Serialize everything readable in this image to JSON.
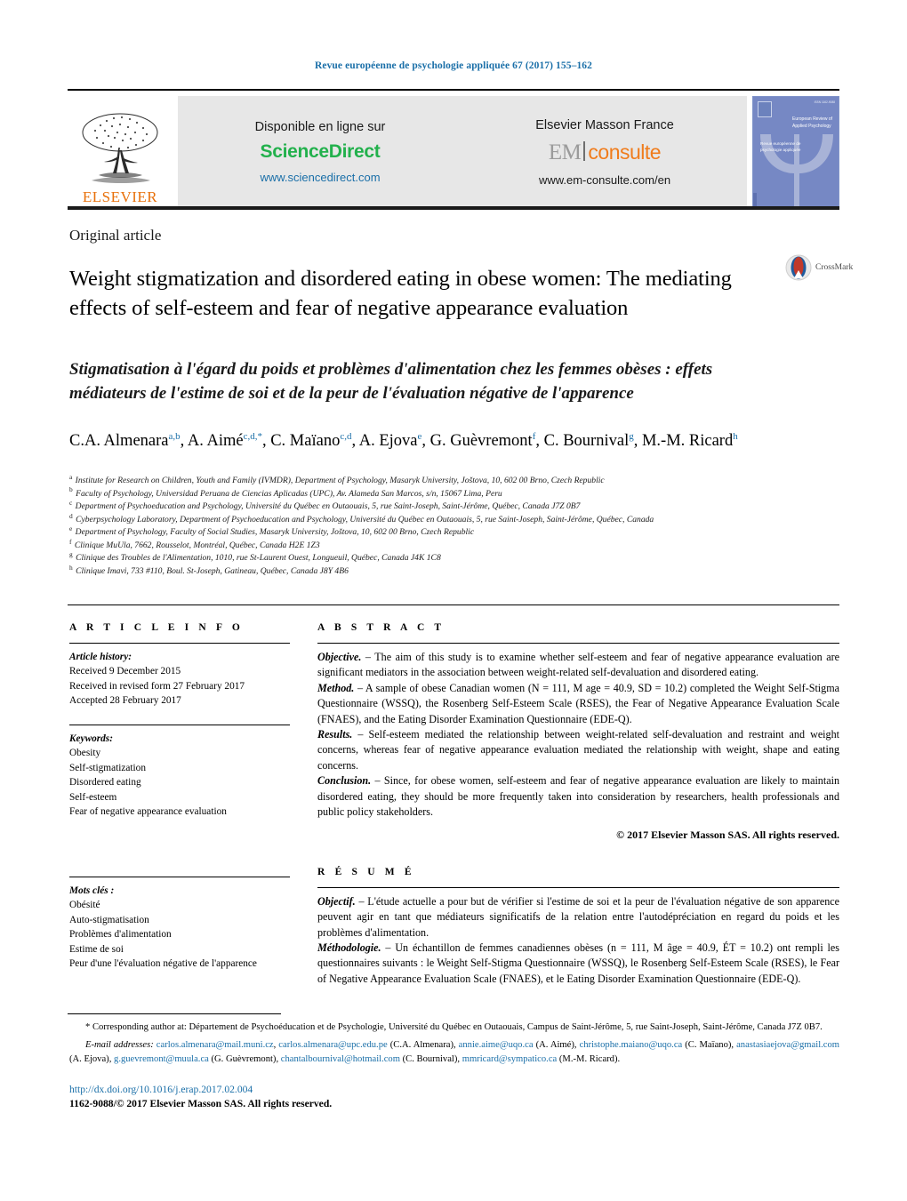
{
  "running_head": "Revue européenne de psychologie appliquée 67 (2017) 155–162",
  "masthead": {
    "publisher_logo_word": "ELSEVIER",
    "left_panel": {
      "lead": "Disponible en ligne sur",
      "brand": "ScienceDirect",
      "url": "www.sciencedirect.com"
    },
    "right_panel": {
      "lead": "Elsevier Masson France",
      "brand_em": "EM",
      "brand_consulte": "consulte",
      "url": "www.em-consulte.com/en"
    },
    "cover": {
      "title_line": "European Review of Applied Psychology",
      "title_line_fr": "Revue européenne de psychologie appliquée",
      "top_right": "ISSN 1162-9088"
    }
  },
  "article_type": "Original article",
  "crossmark": {
    "label": "CrossMark"
  },
  "title_en": "Weight stigmatization and disordered eating in obese women: The mediating effects of self-esteem and fear of negative appearance evaluation",
  "title_fr": "Stigmatisation à l'égard du poids et problèmes d'alimentation chez les femmes obèses : effets médiateurs de l'estime de soi et de la peur de l'évaluation négative de l'apparence",
  "authors": [
    {
      "name": "C.A. Almenara",
      "marks": "a,b"
    },
    {
      "name": "A. Aimé",
      "marks": "c,d,*"
    },
    {
      "name": "C. Maïano",
      "marks": "c,d"
    },
    {
      "name": "A. Ejova",
      "marks": "e"
    },
    {
      "name": "G. Guèvremont",
      "marks": "f"
    },
    {
      "name": "C. Bournival",
      "marks": "g"
    },
    {
      "name": "M.-M. Ricard",
      "marks": "h"
    }
  ],
  "affiliations": [
    {
      "mark": "a",
      "text": "Institute for Research on Children, Youth and Family (IVMDR), Department of Psychology, Masaryk University, Joštova, 10, 602 00 Brno, Czech Republic"
    },
    {
      "mark": "b",
      "text": "Faculty of Psychology, Universidad Peruana de Ciencias Aplicadas (UPC), Av. Alameda San Marcos, s/n, 15067 Lima, Peru"
    },
    {
      "mark": "c",
      "text": "Department of Psychoeducation and Psychology, Université du Québec en Outaouais, 5, rue Saint-Joseph, Saint-Jérôme, Québec, Canada J7Z 0B7"
    },
    {
      "mark": "d",
      "text": "Cyberpsychology Laboratory, Department of Psychoeducation and Psychology, Université du Québec en Outaouais, 5, rue Saint-Joseph, Saint-Jérôme, Québec, Canada"
    },
    {
      "mark": "e",
      "text": "Department of Psychology, Faculty of Social Studies, Masaryk University, Joštova, 10, 602 00 Brno, Czech Republic"
    },
    {
      "mark": "f",
      "text": "Clinique MuUla, 7662, Rousselot, Montréal, Québec, Canada H2E 1Z3"
    },
    {
      "mark": "g",
      "text": "Clinique des Troubles de l'Alimentation, 1010, rue St-Laurent Ouest, Longueuil, Québec, Canada J4K 1C8"
    },
    {
      "mark": "h",
      "text": "Clinique Imavi, 733 #110, Boul. St-Joseph, Gatineau, Québec, Canada J8Y 4B6"
    }
  ],
  "article_info": {
    "heading": "A R T I C L E   I N F O",
    "history_label": "Article history:",
    "history": [
      "Received 9 December 2015",
      "Received in revised form 27 February 2017",
      "Accepted 28 February 2017"
    ],
    "keywords_label": "Keywords:",
    "keywords": [
      "Obesity",
      "Self-stigmatization",
      "Disordered eating",
      "Self-esteem",
      "Fear of negative appearance evaluation"
    ],
    "motscles_label": "Mots clés :",
    "motscles": [
      "Obésité",
      "Auto-stigmatisation",
      "Problèmes d'alimentation",
      "Estime de soi",
      "Peur d'une l'évaluation négative de l'apparence"
    ]
  },
  "abstract": {
    "heading": "A B S T R A C T",
    "paragraphs": [
      {
        "runin": "Objective.",
        "text": " – The aim of this study is to examine whether self-esteem and fear of negative appearance evaluation are significant mediators in the association between weight-related self-devaluation and disordered eating."
      },
      {
        "runin": "Method.",
        "text": " – A sample of obese Canadian women (N = 111, M age = 40.9, SD = 10.2) completed the Weight Self-Stigma Questionnaire (WSSQ), the Rosenberg Self-Esteem Scale (RSES), the Fear of Negative Appearance Evaluation Scale (FNAES), and the Eating Disorder Examination Questionnaire (EDE-Q)."
      },
      {
        "runin": "Results.",
        "text": " – Self-esteem mediated the relationship between weight-related self-devaluation and restraint and weight concerns, whereas fear of negative appearance evaluation mediated the relationship with weight, shape and eating concerns."
      },
      {
        "runin": "Conclusion.",
        "text": " – Since, for obese women, self-esteem and fear of negative appearance evaluation are likely to maintain disordered eating, they should be more frequently taken into consideration by researchers, health professionals and public policy stakeholders."
      }
    ],
    "copyright": "© 2017 Elsevier Masson SAS. All rights reserved."
  },
  "resume": {
    "heading": "R É S U M É",
    "paragraphs": [
      {
        "runin": "Objectif.",
        "text": " – L'étude actuelle a pour but de vérifier si l'estime de soi et la peur de l'évaluation négative de son apparence peuvent agir en tant que médiateurs significatifs de la relation entre l'autodépréciation en regard du poids et les problèmes d'alimentation."
      },
      {
        "runin": "Méthodologie.",
        "text": " – Un échantillon de femmes canadiennes obèses (n = 111, M âge = 40.9, ÉT = 10.2) ont rempli les questionnaires suivants : le Weight Self-Stigma Questionnaire (WSSQ), le Rosenberg Self-Esteem Scale (RSES), le Fear of Negative Appearance Evaluation Scale (FNAES), et le Eating Disorder Examination Questionnaire (EDE-Q)."
      }
    ]
  },
  "footnotes": {
    "corresponding": "* Corresponding author at: Département de Psychoéducation et de Psychologie, Université du Québec en Outaouais, Campus de Saint-Jérôme, 5, rue Saint-Joseph, Saint-Jérôme, Canada J7Z 0B7.",
    "email_label": "E-mail addresses:",
    "emails": [
      {
        "address": "carlos.almenara@mail.muni.cz",
        "owner": ""
      },
      {
        "address": "carlos.almenara@upc.edu.pe",
        "owner": "(C.A. Almenara)"
      },
      {
        "address": "annie.aime@uqo.ca",
        "owner": "(A. Aimé)"
      },
      {
        "address": "christophe.maiano@uqo.ca",
        "owner": "(C. Maïano)"
      },
      {
        "address": "anastasiaejova@gmail.com",
        "owner": "(A. Ejova)"
      },
      {
        "address": "g.guevremont@muula.ca",
        "owner": "(G. Guèvremont)"
      },
      {
        "address": "chantalbournival@hotmail.com",
        "owner": "(C. Bournival)"
      },
      {
        "address": "mmricard@sympatico.ca",
        "owner": "(M.-M. Ricard)"
      }
    ]
  },
  "doi": "http://dx.doi.org/10.1016/j.erap.2017.02.004",
  "issn_line": "1162-9088/© 2017 Elsevier Masson SAS. All rights reserved."
}
